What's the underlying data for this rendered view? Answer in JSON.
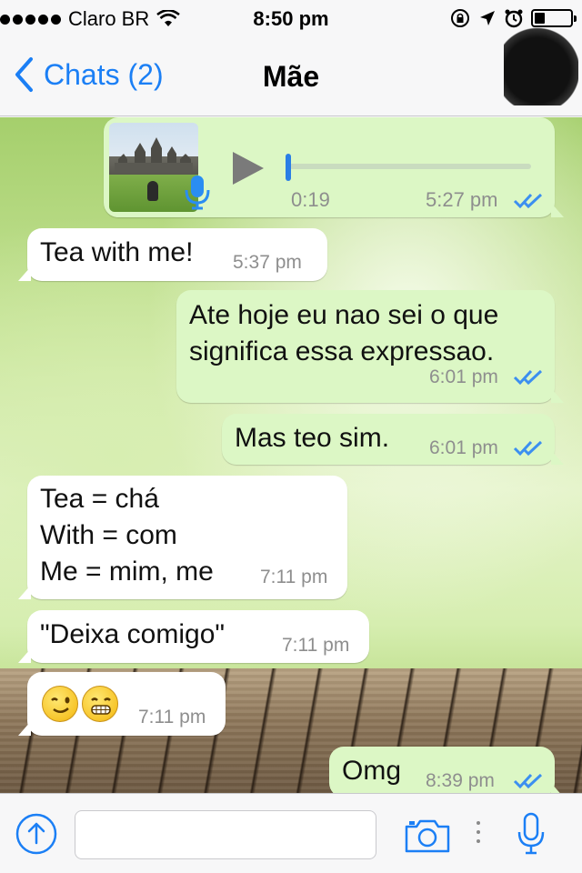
{
  "status_bar": {
    "carrier": "Claro BR",
    "time": "8:50 pm",
    "battery_level": 0.3
  },
  "nav": {
    "back_label": "Chats (2)",
    "title": "Mãe"
  },
  "messages": [
    {
      "direction": "out",
      "type": "voice",
      "duration": "0:19",
      "time": "5:27 pm",
      "read": true
    },
    {
      "direction": "in",
      "text": "Tea with me!",
      "time": "5:37 pm"
    },
    {
      "direction": "out",
      "text": "Ate hoje eu nao sei o que\nsignifica essa expressao.",
      "time": "6:01 pm",
      "read": true
    },
    {
      "direction": "out",
      "text": "Mas teo sim.",
      "time": "6:01 pm",
      "read": true
    },
    {
      "direction": "in",
      "text": "Tea = chá\nWith = com\nMe = mim, me",
      "time": "7:11 pm"
    },
    {
      "direction": "in",
      "text": "\"Deixa comigo\"",
      "time": "7:11 pm"
    },
    {
      "direction": "in",
      "type": "emoji",
      "emojis": [
        "winking-face",
        "grimacing-face"
      ],
      "time": "7:11 pm"
    },
    {
      "direction": "out",
      "text": "Omg",
      "time": "8:39 pm",
      "read": true
    }
  ],
  "input": {
    "placeholder": ""
  },
  "colors": {
    "accent": "#1b7ff5",
    "outgoing_bubble": "#dcf7c5",
    "incoming_bubble": "#ffffff",
    "read_ticks": "#3c8ff0"
  }
}
